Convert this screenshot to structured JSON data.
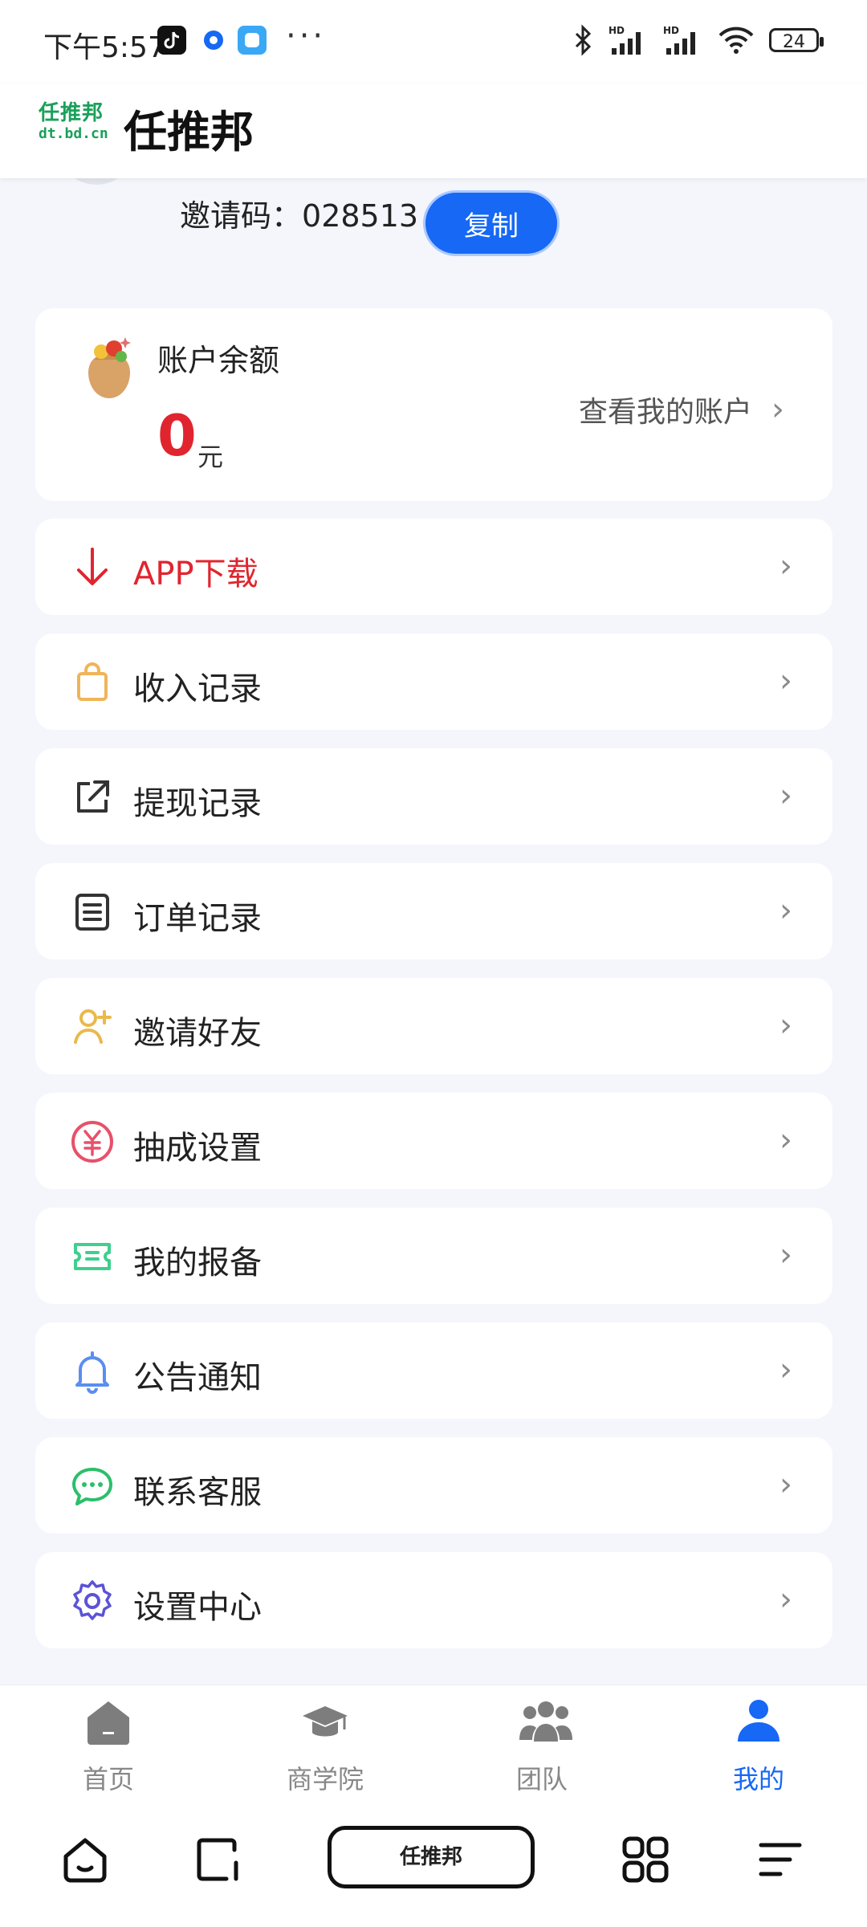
{
  "status_bar": {
    "time": "下午5:57",
    "battery": "24"
  },
  "header": {
    "logo_line1": "任推邦",
    "logo_line2": "dt.bd.cn",
    "title": "任推邦"
  },
  "invite": {
    "label": "邀请码：",
    "code": "028513",
    "copy_label": "复制"
  },
  "balance": {
    "label": "账户余额",
    "value": "0",
    "unit": "元",
    "link_label": "查看我的账户"
  },
  "menu": [
    {
      "label": "APP下载",
      "icon": "download-arrow-icon",
      "color": "#e0252f"
    },
    {
      "label": "收入记录",
      "icon": "shopping-bag-icon",
      "color": "#f0b45a"
    },
    {
      "label": "提现记录",
      "icon": "external-link-icon",
      "color": "#333333"
    },
    {
      "label": "订单记录",
      "icon": "clipboard-list-icon",
      "color": "#333333"
    },
    {
      "label": "邀请好友",
      "icon": "add-user-icon",
      "color": "#e9b94c"
    },
    {
      "label": "抽成设置",
      "icon": "yuan-circle-icon",
      "color": "#e8506a"
    },
    {
      "label": "我的报备",
      "icon": "ticket-icon",
      "color": "#3fcf8e"
    },
    {
      "label": "公告通知",
      "icon": "bell-icon",
      "color": "#5a8ef0"
    },
    {
      "label": "联系客服",
      "icon": "chat-bubble-icon",
      "color": "#2bbf6a"
    },
    {
      "label": "设置中心",
      "icon": "gear-icon",
      "color": "#5b53d6"
    }
  ],
  "tabs": [
    {
      "label": "首页",
      "icon": "home-icon"
    },
    {
      "label": "商学院",
      "icon": "graduation-cap-icon"
    },
    {
      "label": "团队",
      "icon": "team-icon"
    },
    {
      "label": "我的",
      "icon": "user-icon",
      "active": true
    }
  ],
  "system_nav": {
    "pill_label": "任推邦"
  },
  "colors": {
    "accent": "#1668f5",
    "danger": "#e0252f",
    "background": "#f4f6fb"
  }
}
